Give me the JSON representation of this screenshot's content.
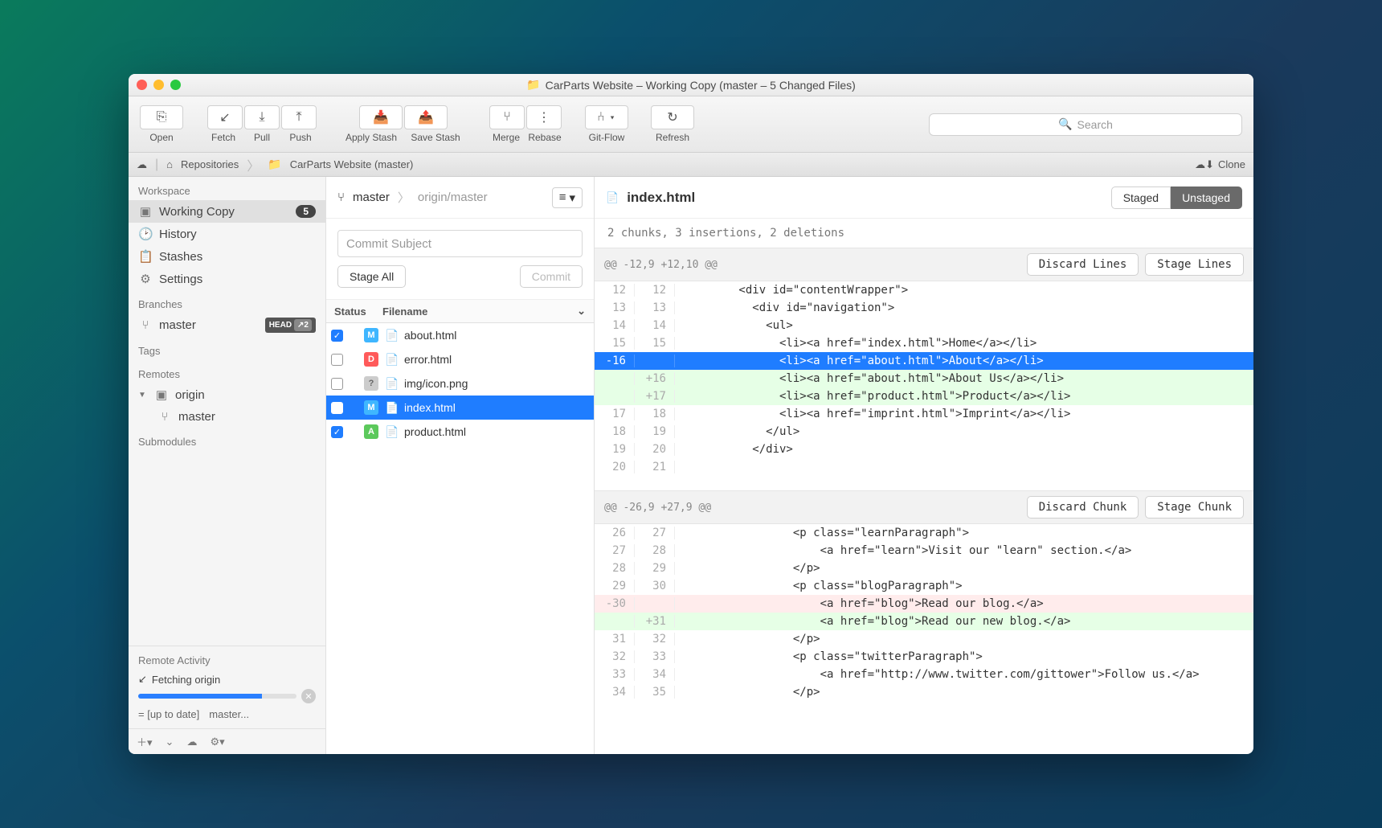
{
  "window": {
    "title": "CarParts Website – Working Copy (master – 5 Changed Files)"
  },
  "toolbar": {
    "open": "Open",
    "fetch": "Fetch",
    "pull": "Pull",
    "push": "Push",
    "apply_stash": "Apply Stash",
    "save_stash": "Save Stash",
    "merge": "Merge",
    "rebase": "Rebase",
    "gitflow": "Git-Flow",
    "refresh": "Refresh",
    "search_placeholder": "Search"
  },
  "breadcrumb": {
    "repositories": "Repositories",
    "project": "CarParts Website (master)",
    "clone": "Clone"
  },
  "sidebar": {
    "workspace_header": "Workspace",
    "working_copy": "Working Copy",
    "working_copy_badge": "5",
    "history": "History",
    "stashes": "Stashes",
    "settings": "Settings",
    "branches_header": "Branches",
    "branch_master": "master",
    "head_label": "HEAD",
    "head_ahead": "↗2",
    "tags_header": "Tags",
    "remotes_header": "Remotes",
    "remote_origin": "origin",
    "remote_origin_master": "master",
    "submodules_header": "Submodules",
    "remote_activity_header": "Remote Activity",
    "fetching": "Fetching origin",
    "status_uptodate": "= [up to date]",
    "status_branch": "master..."
  },
  "center": {
    "branch_local": "master",
    "branch_remote": "origin/master",
    "commit_subject_placeholder": "Commit Subject",
    "stage_all": "Stage All",
    "commit": "Commit",
    "col_status": "Status",
    "col_filename": "Filename",
    "files": [
      {
        "checked": true,
        "status": "M",
        "badge_class": "sm-M",
        "name": "about.html"
      },
      {
        "checked": false,
        "status": "D",
        "badge_class": "sm-D",
        "name": "error.html"
      },
      {
        "checked": false,
        "status": "?",
        "badge_class": "sm-Q",
        "name": "img/icon.png"
      },
      {
        "checked": false,
        "status": "M",
        "badge_class": "sm-M",
        "name": "index.html",
        "selected": true
      },
      {
        "checked": true,
        "status": "A",
        "badge_class": "sm-A",
        "name": "product.html"
      }
    ]
  },
  "diff": {
    "filename": "index.html",
    "staged": "Staged",
    "unstaged": "Unstaged",
    "summary": "2 chunks, 3 insertions, 2 deletions",
    "discard_lines": "Discard Lines",
    "stage_lines": "Stage Lines",
    "discard_chunk": "Discard Chunk",
    "stage_chunk": "Stage Chunk",
    "hunk1_header": "@@ -12,9 +12,10 @@",
    "hunk2_header": "@@ -26,9 +27,9 @@",
    "lines1": [
      {
        "old": "12",
        "new": "12",
        "t": "ctx",
        "code": "        <div id=\"contentWrapper\">"
      },
      {
        "old": "13",
        "new": "13",
        "t": "ctx",
        "code": "          <div id=\"navigation\">"
      },
      {
        "old": "14",
        "new": "14",
        "t": "ctx",
        "code": "            <ul>"
      },
      {
        "old": "15",
        "new": "15",
        "t": "ctx",
        "code": "              <li><a href=\"index.html\">Home</a></li>"
      },
      {
        "old": "-16",
        "new": "",
        "t": "sel-del",
        "code": "              <li><a href=\"about.html\">About</a></li>"
      },
      {
        "old": "",
        "new": "+16",
        "t": "add",
        "code": "              <li><a href=\"about.html\">About Us</a></li>"
      },
      {
        "old": "",
        "new": "+17",
        "t": "add",
        "code": "              <li><a href=\"product.html\">Product</a></li>"
      },
      {
        "old": "17",
        "new": "18",
        "t": "ctx",
        "code": "              <li><a href=\"imprint.html\">Imprint</a></li>"
      },
      {
        "old": "18",
        "new": "19",
        "t": "ctx",
        "code": "            </ul>"
      },
      {
        "old": "19",
        "new": "20",
        "t": "ctx",
        "code": "          </div>"
      },
      {
        "old": "20",
        "new": "21",
        "t": "ctx",
        "code": ""
      }
    ],
    "lines2": [
      {
        "old": "26",
        "new": "27",
        "t": "ctx",
        "code": "                <p class=\"learnParagraph\">"
      },
      {
        "old": "27",
        "new": "28",
        "t": "ctx",
        "code": "                    <a href=\"learn\">Visit our \"learn\" section.</a>"
      },
      {
        "old": "28",
        "new": "29",
        "t": "ctx",
        "code": "                </p>"
      },
      {
        "old": "29",
        "new": "30",
        "t": "ctx",
        "code": "                <p class=\"blogParagraph\">"
      },
      {
        "old": "-30",
        "new": "",
        "t": "del",
        "code": "                    <a href=\"blog\">Read our blog.</a>"
      },
      {
        "old": "",
        "new": "+31",
        "t": "add",
        "code": "                    <a href=\"blog\">Read our new blog.</a>"
      },
      {
        "old": "31",
        "new": "32",
        "t": "ctx",
        "code": "                </p>"
      },
      {
        "old": "32",
        "new": "33",
        "t": "ctx",
        "code": "                <p class=\"twitterParagraph\">"
      },
      {
        "old": "33",
        "new": "34",
        "t": "ctx",
        "code": "                    <a href=\"http://www.twitter.com/gittower\">Follow us.</a>"
      },
      {
        "old": "34",
        "new": "35",
        "t": "ctx",
        "code": "                </p>"
      }
    ]
  }
}
